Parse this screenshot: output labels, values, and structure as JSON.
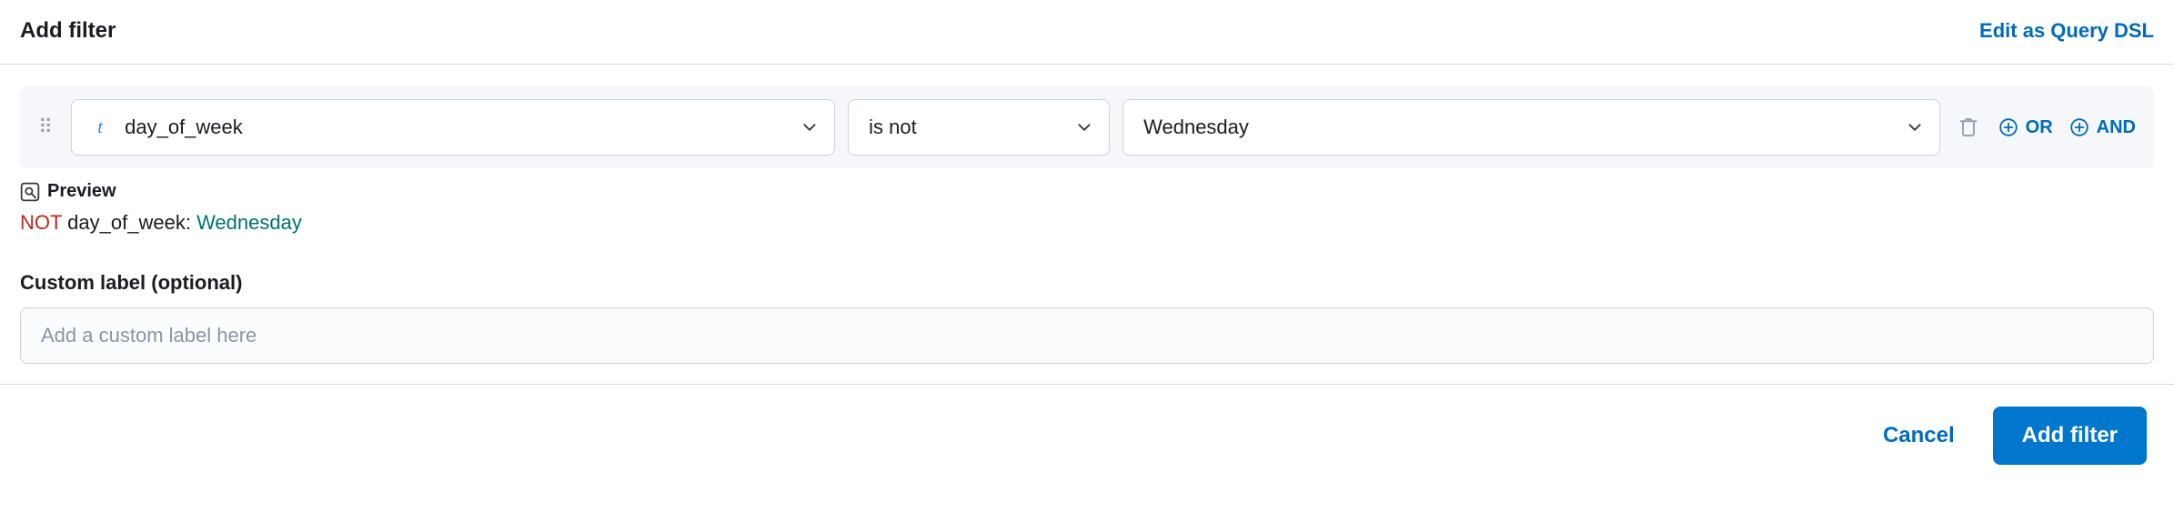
{
  "header": {
    "title": "Add filter",
    "edit_link": "Edit as Query DSL"
  },
  "filter": {
    "field_type_glyph": "t",
    "field": "day_of_week",
    "operator": "is not",
    "value": "Wednesday",
    "or_label": "OR",
    "and_label": "AND"
  },
  "preview": {
    "label": "Preview",
    "token_not": "NOT",
    "token_field": "day_of_week:",
    "token_value": "Wednesday"
  },
  "custom_label": {
    "label": "Custom label (optional)",
    "placeholder": "Add a custom label here"
  },
  "footer": {
    "cancel": "Cancel",
    "submit": "Add filter"
  }
}
